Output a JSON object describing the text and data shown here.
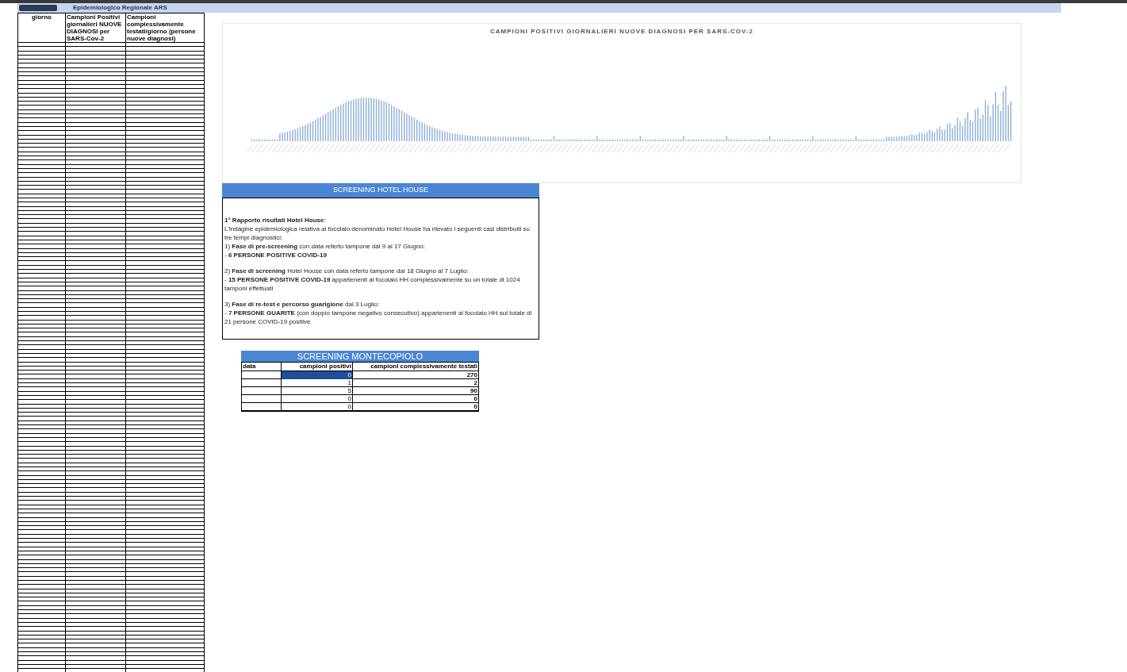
{
  "banner": {
    "title": "Epidemiologico Regionale ARS"
  },
  "daily_table": {
    "columns": [
      "giorno",
      "Campioni Positivi giornalieri NUOVE DIAGNOSI per SARS-Cov-2",
      "Campioni complessivamente testati/giorno (persone nuove diagnosi)"
    ]
  },
  "chart": {
    "title": "CAMPIONI POSITIVI GIORNALIERI NUOVE DIAGNOSI PER SARS-COV-2"
  },
  "hotel_house": {
    "title": "SCREENING HOTEL HOUSE",
    "blocks": [
      [
        "**1° Rapporto  risultati Hotel House**:",
        "L'indagine epidemiologica relativa al focolaio denominato Hotel House ha rilevato i seguenti casi distribuiti su tre tempi diagnostici:",
        "1) **Fase di pre-screening** con data referto tampone dal 9 al 17 Giugno:",
        "- **6 PERSONE POSITIVE COVID-19**"
      ],
      [
        "2) **Fase di screening** Hotel House con data referto tampone dal 18 Giugno al 7 Luglio:",
        "- **15 PERSONE POSITIVE COVID-19** appartenenti al focolaio HH complessivamente su un totale di 1024 tamponi effettuati"
      ],
      [
        "3) **Fase di re-test e percorso guarigione** dal 3 Luglio:",
        "- **7 PERSONE GUARITE** (con doppio tampone negativo consecutivo) appartenenti al focolaio HH sul totale di 21 persone COVID-19 positive"
      ]
    ]
  },
  "montecopiolo": {
    "title": "SCREENING MONTECOPIOLO",
    "columns": [
      "data",
      "campioni positivi",
      "campioni complessivamente testati"
    ],
    "rows": [
      {
        "positivi": "0",
        "testati": "270",
        "selected": true
      },
      {
        "positivi": "1",
        "testati": "2",
        "selected": false
      },
      {
        "positivi": "5",
        "testati": "90",
        "selected": false
      },
      {
        "positivi": "0",
        "testati": "0",
        "selected": false
      },
      {
        "positivi": "0",
        "testati": "0",
        "selected": false
      }
    ]
  }
}
